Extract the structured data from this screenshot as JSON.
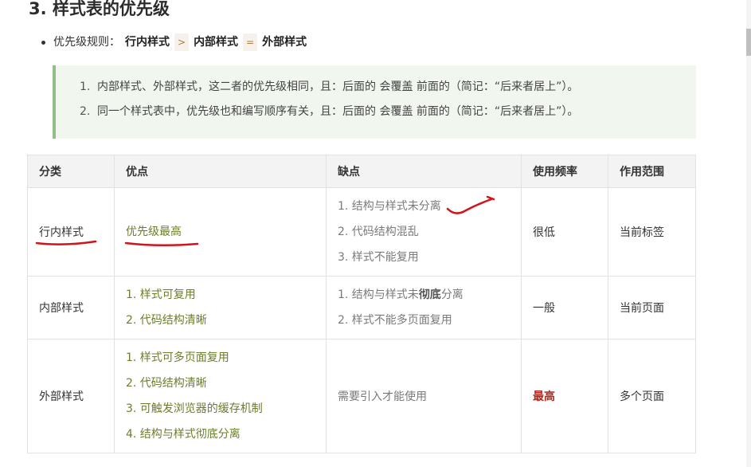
{
  "heading": "3. 样式表的优先级",
  "rule": {
    "prefix": "优先级规则：",
    "inline": "行内样式",
    "gt": ">",
    "internal": "内部样式",
    "eq": "=",
    "external": "外部样式"
  },
  "notes": [
    {
      "num": "1.",
      "text": "内部样式、外部样式，这二者的优先级相同，且：后面的 会覆盖 前面的（简记：“后来者居上”）。"
    },
    {
      "num": "2.",
      "text": "同一个样式表中，优先级也和编写顺序有关，且：后面的 会覆盖 前面的（简记：“后来者居上”）。"
    }
  ],
  "table": {
    "headers": [
      "分类",
      "优点",
      "缺点",
      "使用频率",
      "作用范围"
    ],
    "rows": [
      {
        "category": "行内样式",
        "pros": [
          "优先级最高"
        ],
        "cons": [
          "1. 结构与样式未分离",
          "2. 代码结构混乱",
          "3. 样式不能复用"
        ],
        "frequency": "很低",
        "scope": "当前标签"
      },
      {
        "category": "内部样式",
        "pros": [
          "1. 样式可复用",
          "2. 代码结构清晰"
        ],
        "cons_a_pre": "1. 结构与样式未",
        "cons_a_bold": "彻底",
        "cons_a_post": "分离",
        "cons_b": "2. 样式不能多页面复用",
        "frequency": "一般",
        "scope": "当前页面"
      },
      {
        "category": "外部样式",
        "pros": [
          "1. 样式可多页面复用",
          "2. 代码结构清晰",
          "3. 可触发浏览器的缓存机制",
          "4. 结构与样式彻底分离"
        ],
        "cons": [
          "需要引入才能使用"
        ],
        "frequency": "最高",
        "scope": "多个页面"
      }
    ]
  },
  "colors": {
    "pros_text": "#6b7f2a",
    "highest": "#b4281d",
    "note_bg": "#f1f6ef",
    "note_border": "#90bf88",
    "annotation_ink": "#d0141b"
  }
}
